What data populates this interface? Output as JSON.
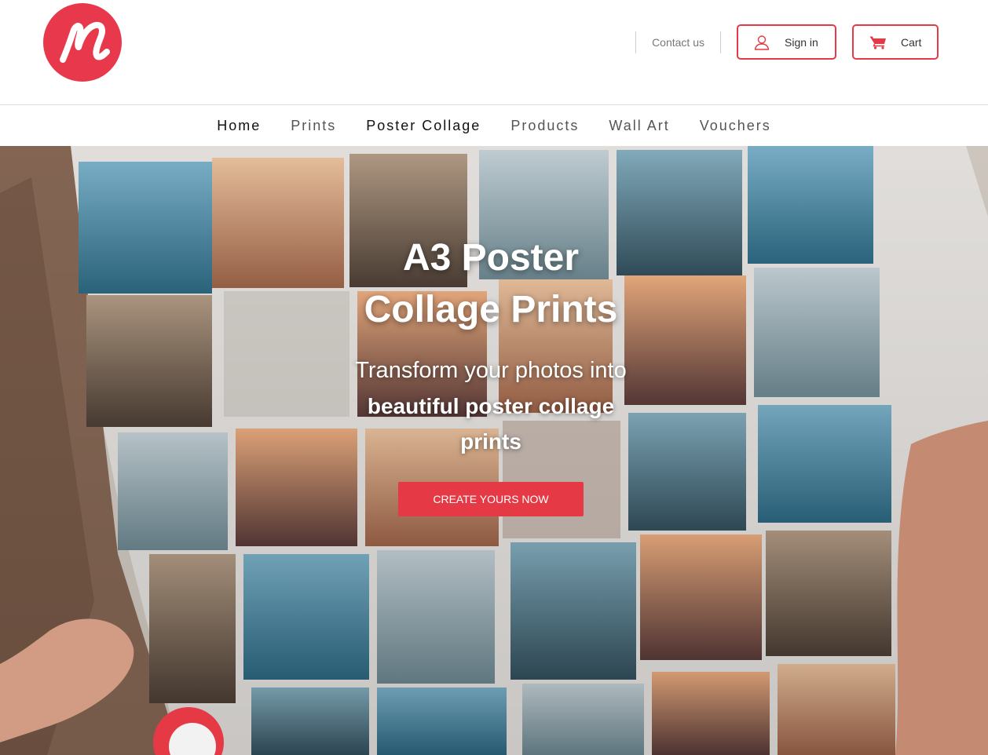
{
  "brand": {
    "logo_icon": "script-n-logo",
    "accent_color": "#e63946"
  },
  "header": {
    "contact_label": "Contact us",
    "signin_label": "Sign in",
    "cart_label": "Cart"
  },
  "nav": {
    "items": [
      {
        "label": "Home"
      },
      {
        "label": "Prints"
      },
      {
        "label": "Poster Collage"
      },
      {
        "label": "Products"
      },
      {
        "label": "Wall Art"
      },
      {
        "label": "Vouchers"
      }
    ]
  },
  "hero": {
    "title_line1": "A3 Poster",
    "title_line2": "Collage Prints",
    "subtitle_line1": "Transform your photos into",
    "subtitle_line2": "beautiful poster collage",
    "subtitle_line3": "prints",
    "cta_label": "CREATE YOURS NOW"
  }
}
